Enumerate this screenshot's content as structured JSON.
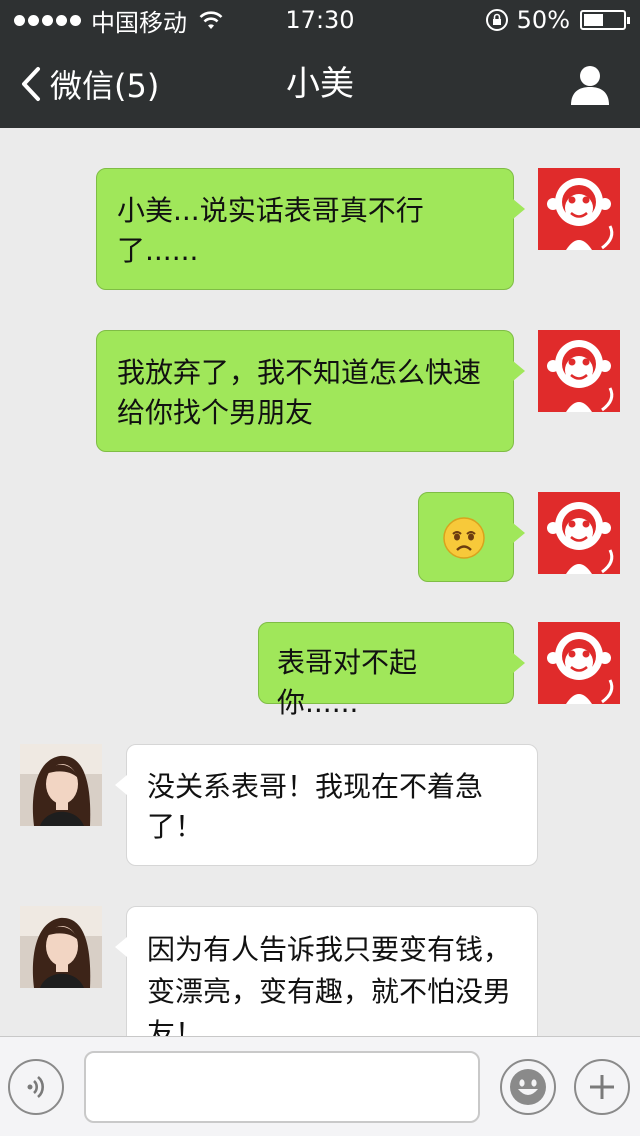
{
  "status_bar": {
    "carrier": "中国移动",
    "time": "17:30",
    "battery": "50%",
    "battery_level": 0.5,
    "signal_icon": "signal-dots-icon",
    "wifi_icon": "wifi-icon"
  },
  "nav": {
    "back_label": "微信(5)",
    "title": "小美",
    "profile_icon": "person-icon"
  },
  "messages": [
    {
      "sender": "me",
      "text": "小美...说实话表哥真不行了......"
    },
    {
      "sender": "me",
      "text": "我放弃了，我不知道怎么快速给你找个男朋友"
    },
    {
      "sender": "me",
      "emoji": "sad-face-emoji"
    },
    {
      "sender": "me",
      "text": "表哥对不起你......"
    },
    {
      "sender": "other",
      "text": "没关系表哥！我现在不着急了！"
    },
    {
      "sender": "other",
      "text": "因为有人告诉我只要变有钱，变漂亮，变有趣，就不怕没男友！"
    }
  ],
  "input_bar": {
    "voice_icon": "voice-icon",
    "text_value": "",
    "emoji_icon": "smiley-icon",
    "plus_icon": "plus-icon"
  },
  "colors": {
    "header_bg": "#2e3132",
    "chat_bg": "#ebebeb",
    "outgoing_bubble": "#a0e75a",
    "incoming_bubble": "#ffffff",
    "my_avatar_bg": "#e02b2b"
  }
}
